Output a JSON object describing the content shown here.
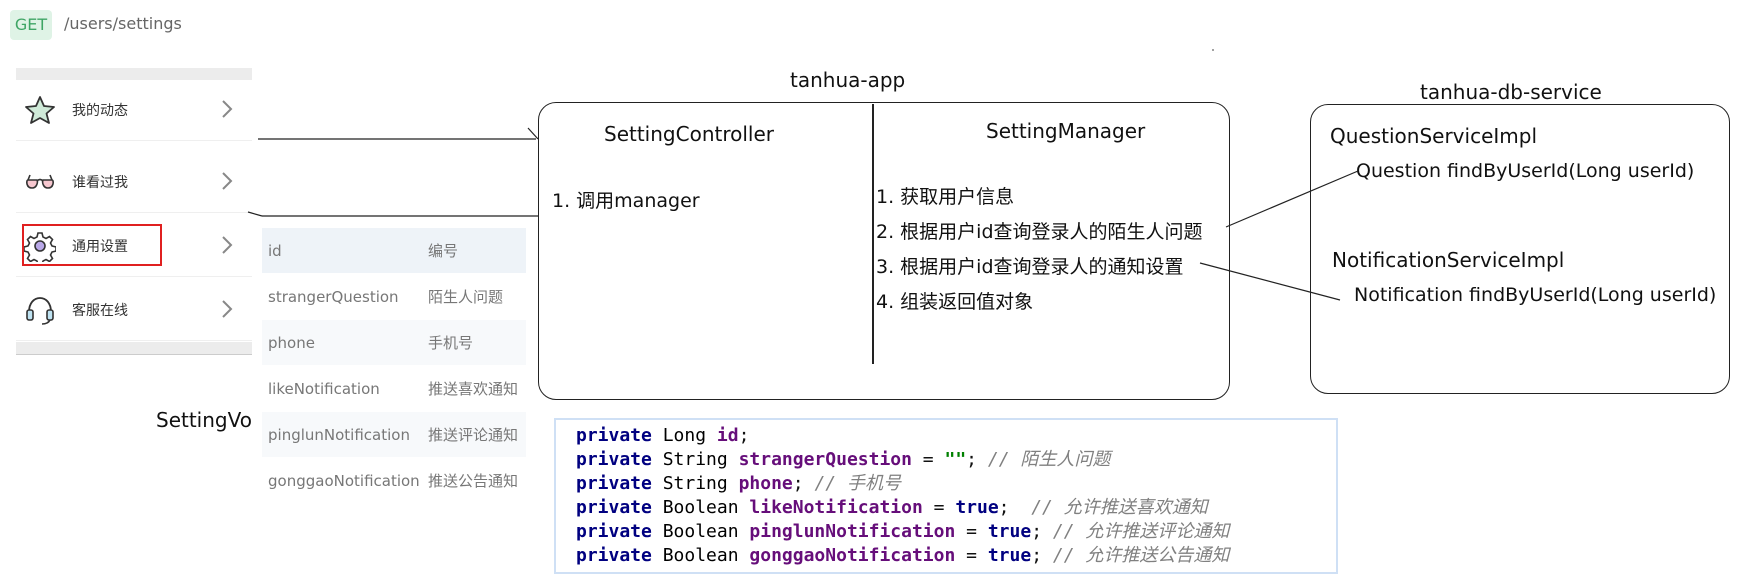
{
  "request": {
    "method": "GET",
    "path": "/users/settings"
  },
  "menu": {
    "items": [
      {
        "label": "我的动态",
        "icon": "star-icon"
      },
      {
        "label": "谁看过我",
        "icon": "glasses-icon"
      },
      {
        "label": "通用设置",
        "icon": "gear-icon"
      },
      {
        "label": "客服在线",
        "icon": "headset-icon"
      }
    ]
  },
  "vo": {
    "label": "SettingVo",
    "rows": [
      {
        "field": "id",
        "desc": "编号"
      },
      {
        "field": "strangerQuestion",
        "desc": "陌生人问题"
      },
      {
        "field": "phone",
        "desc": "手机号"
      },
      {
        "field": "likeNotification",
        "desc": "推送喜欢通知"
      },
      {
        "field": "pinglunNotification",
        "desc": "推送评论通知"
      },
      {
        "field": "gonggaoNotification",
        "desc": "推送公告通知"
      }
    ]
  },
  "app": {
    "title": "tanhua-app",
    "controller": {
      "title": "SettingController",
      "steps": [
        "1. 调用manager"
      ]
    },
    "manager": {
      "title": "SettingManager",
      "steps": [
        "1. 获取用户信息",
        "2. 根据用户id查询登录人的陌生人问题",
        "3. 根据用户id查询登录人的通知设置",
        "4. 组装返回值对象"
      ]
    }
  },
  "db": {
    "title": "tanhua-db-service",
    "question": {
      "title": "QuestionServiceImpl",
      "method": "Question findByUserId(Long userId)"
    },
    "notification": {
      "title": "NotificationServiceImpl",
      "method": "Notification findByUserId(Long userId)"
    }
  },
  "code": {
    "lines": [
      {
        "kw": "private",
        "type": "Long",
        "field": "id",
        "init": "",
        "tail": ";",
        "comment": ""
      },
      {
        "kw": "private",
        "type": "String",
        "field": "strangerQuestion",
        "init": "\"\"",
        "tail": ";",
        "comment": "// 陌生人问题"
      },
      {
        "kw": "private",
        "type": "String",
        "field": "phone",
        "init": "",
        "tail": ";",
        "comment": "// 手机号"
      },
      {
        "kw": "private",
        "type": "Boolean",
        "field": "likeNotification",
        "init": "true",
        "tail": ";",
        "comment": "// 允许推送喜欢通知"
      },
      {
        "kw": "private",
        "type": "Boolean",
        "field": "pinglunNotification",
        "init": "true",
        "tail": ";",
        "comment": "// 允许推送评论通知"
      },
      {
        "kw": "private",
        "type": "Boolean",
        "field": "gonggaoNotification",
        "init": "true",
        "tail": ";",
        "comment": "// 允许推送公告通知"
      }
    ]
  },
  "colors": {
    "highlight_border": "#e02020",
    "badge_bg": "#dff3e6",
    "badge_text": "#3fa565"
  }
}
